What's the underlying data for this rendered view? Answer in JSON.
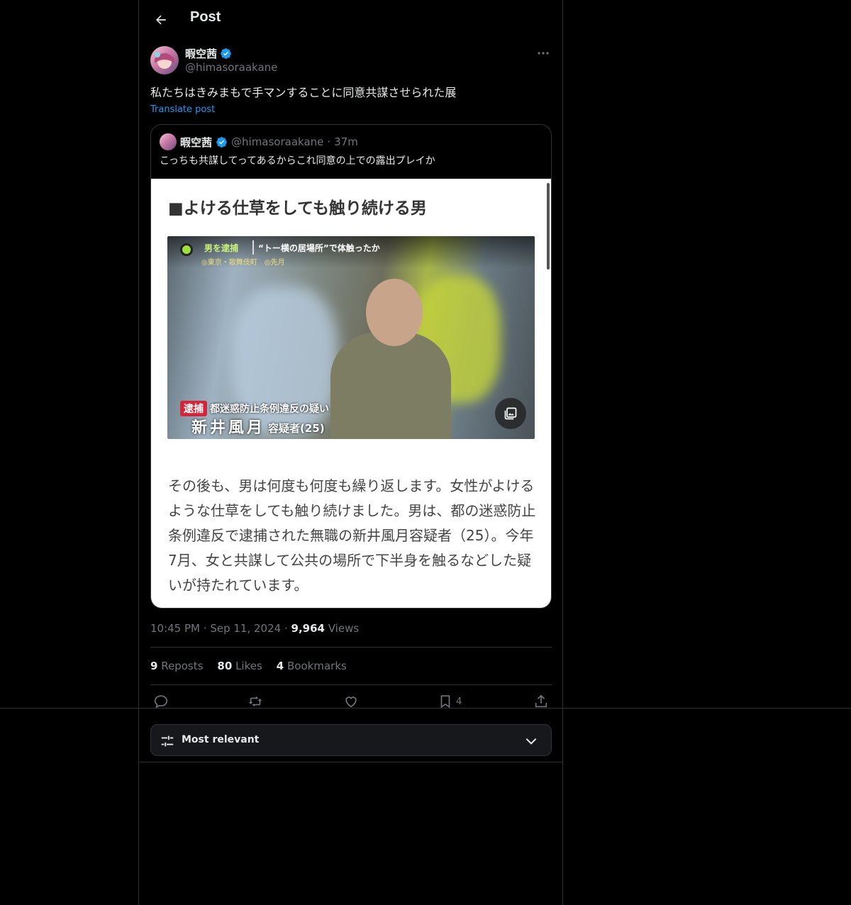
{
  "header": {
    "title": "Post"
  },
  "post": {
    "author_name": "暇空茜",
    "author_handle": "@himasoraakane",
    "text": "私たちはきみまもで手マンすることに同意共謀させられた展",
    "translate_label": "Translate post",
    "time": "10:45 PM",
    "date": "Sep 11, 2024",
    "views_count": "9,964",
    "views_label": "Views",
    "reposts_count": "9",
    "reposts_label": "Reposts",
    "likes_count": "80",
    "likes_label": "Likes",
    "bookmarks_count": "4",
    "bookmarks_label": "Bookmarks",
    "bookmark_action_count": "4",
    "dot": "·"
  },
  "quote": {
    "author_name": "暇空茜",
    "author_handle": "@himasoraakane",
    "time": "37m",
    "text": "こっちも共謀してってあるからこれ同意の上での露出プレイか",
    "article": {
      "heading": "■よける仕草をしても触り続ける男",
      "ticker_label": "男を逮捕",
      "ticker_headline": "“トー横の居場所”で体触ったか",
      "ticker_location": "◎東京・歌舞伎町　◎先月",
      "caption_tag": "逮捕",
      "caption_charge": "都迷惑防止条例違反の疑い",
      "caption_name": "新井風月",
      "caption_role": "容疑者(25)",
      "body": "その後も、男は何度も何度も繰り返します。女性がよけるような仕草をしても触り続けました。男は、都の迷惑防止条例違反で逮捕された無職の新井風月容疑者（25）。今年7月、女と共謀して公共の場所で下半身を触るなどした疑いが持たれています。"
    }
  },
  "sort": {
    "label": "Most relevant"
  },
  "colors": {
    "accent": "#1d9bf0",
    "background": "#000000",
    "muted": "#71767b",
    "border": "#2f3336"
  }
}
